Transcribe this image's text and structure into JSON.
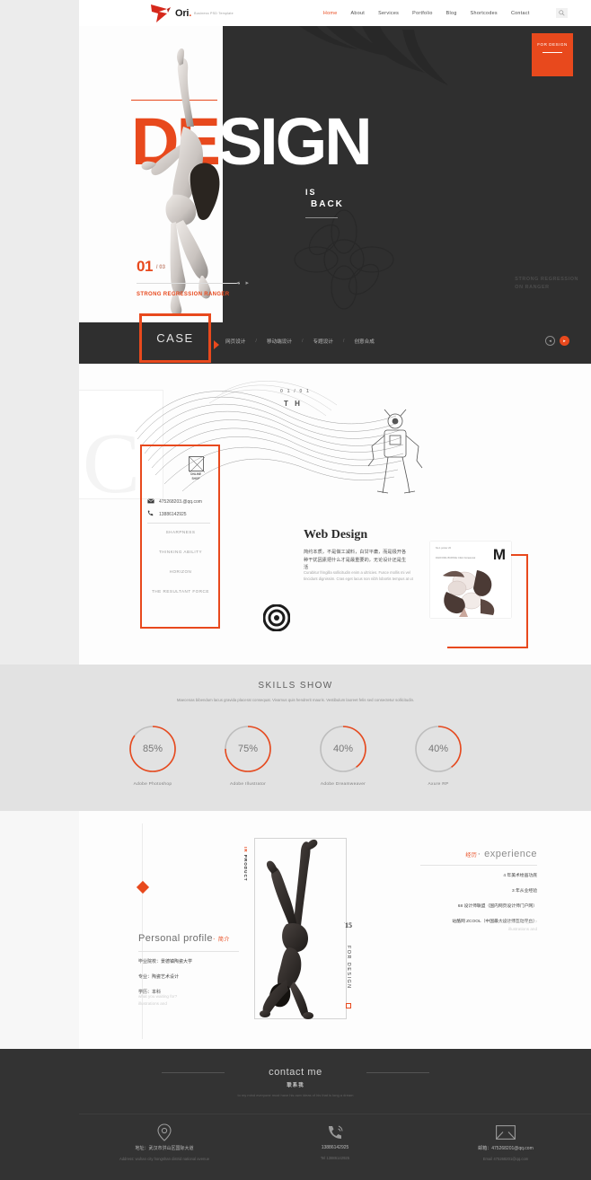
{
  "header": {
    "logo_text": "Ori",
    "logo_dot": ".",
    "logo_tagline": "Business PSD Template",
    "nav": [
      {
        "label": "Home",
        "active": true
      },
      {
        "label": "About",
        "active": false
      },
      {
        "label": "Services",
        "active": false
      },
      {
        "label": "Portfolio",
        "active": false
      },
      {
        "label": "Blog",
        "active": false
      },
      {
        "label": "Shortcodes",
        "active": false
      },
      {
        "label": "Contact",
        "active": false
      }
    ],
    "search_icon": "search-icon"
  },
  "hero": {
    "badge": "FOR DESIGN",
    "word_part1": "DE",
    "word_part2": "SIGN",
    "is": "IS",
    "back": "BACK",
    "slide_number": "01",
    "slide_total": "/ 03",
    "caption": "STRONG REGRESSION RANGER",
    "right_label_line1": "STRONG REGRESSION",
    "right_label_line2": "ON RANGER",
    "arrow_prev": "◂",
    "arrow_next": "▸"
  },
  "casebar": {
    "title": "CASE",
    "items": [
      "网页设计",
      "移动端设计",
      "专题设计",
      "创意合成"
    ],
    "separator": "/",
    "prev": "◂",
    "next": "▸"
  },
  "case": {
    "counter": "0 1 / 0 1",
    "counter_label": "T H",
    "shop_label_1": "ONLINE",
    "shop_label_2": "SHOP",
    "email": "475268203.@qq.com",
    "phone": "13886142925",
    "email_icon": "envelope-icon",
    "phone_icon": "phone-icon",
    "keywords": [
      "SHARPNESS",
      "THINKING ABILITY",
      "HORIZON",
      "THE RESULTANT FORCE"
    ],
    "title": "Web Design",
    "body_cn": "简约本质，不是做工减料，白甘平庸，而是极开各种干扰因素把什么才是最重要的，无论设计还是生活",
    "body_en": "Curabitur fringilla sollicitudin enim a ultricies. Fusce mollis mi vel tincidunt dignissim. Cras eget lacus non nibh lobortis tempus at ut",
    "card_letter": "M",
    "card_text_1": "No.1 poster 20",
    "card_text_2": "DAFFODIL\nBURSSH\nClick Occasional"
  },
  "skills": {
    "title": "SKILLS SHOW",
    "description": "Maecenas bibendum lacus gravida placerat consequat. Vivamus quis hendrerit mauris. Vestibulum laoreet felis sed consectetur sollicitudin."
  },
  "chart_data": {
    "type": "bar",
    "title": "SKILLS SHOW",
    "categories": [
      "Adobe Photoshop",
      "Adobe Illustrator",
      "Adobe Dreamweaver",
      "Axure RP"
    ],
    "values": [
      85,
      75,
      40,
      40
    ],
    "labels": [
      "85%",
      "75%",
      "40%",
      "40%"
    ],
    "unit": "%",
    "ylim": [
      0,
      100
    ],
    "xlabel": "",
    "ylabel": "",
    "legend": "none",
    "grid": false,
    "render_as": "donut-progress-rings",
    "accent_color": "#e8491d",
    "track_color": "#bdbdbd"
  },
  "profile": {
    "vertical_text_red": "IR",
    "vertical_text": "PRODUCT",
    "photo_year": "15",
    "photo_year_sup": "'",
    "photo_caption": "FOR DESIGN",
    "title_en": "Personal profile",
    "title_dot": "·",
    "title_cn": "简介",
    "lines": [
      "毕业院校：景德镇陶瓷大学",
      "专业：陶瓷艺术设计",
      "学历：本科"
    ],
    "faint_1": "what you waiting for?",
    "faint_2": "illustrations and"
  },
  "experience": {
    "title_cn": "经历",
    "title_dot": "·",
    "title_en": "experience",
    "lines": [
      "4 年美术绘画功底",
      "3 年从业经验",
      "68 设计师联盟（国内网页设计师门户网）",
      "站酷网 ZCOOL（中国最大设计师互动平台）"
    ],
    "faint_1": "what you waiting for?",
    "faint_2": "illustrations and"
  },
  "footer": {
    "title": "contact me",
    "title_cn": "联系我",
    "description": "to my mind everyone must have his own ideas of his that is long a dream",
    "columns": [
      {
        "icon": "location-pin-icon",
        "line1": "地址：武汉市洪山区国际大道",
        "line2": "Address: wuhan city  hongshan distrid national avenue"
      },
      {
        "icon": "phone-icon",
        "line1": "13886142925",
        "line2": "Tel 13886142925"
      },
      {
        "icon": "envelope-icon",
        "line1": "邮箱：475268201@qq.com",
        "line2": "Email 475268201@qq.com"
      }
    ]
  },
  "colors": {
    "accent": "#e8491d",
    "dark": "#2f2f2f",
    "footer_bg": "#333333",
    "skills_bg": "#e2e2e2"
  }
}
